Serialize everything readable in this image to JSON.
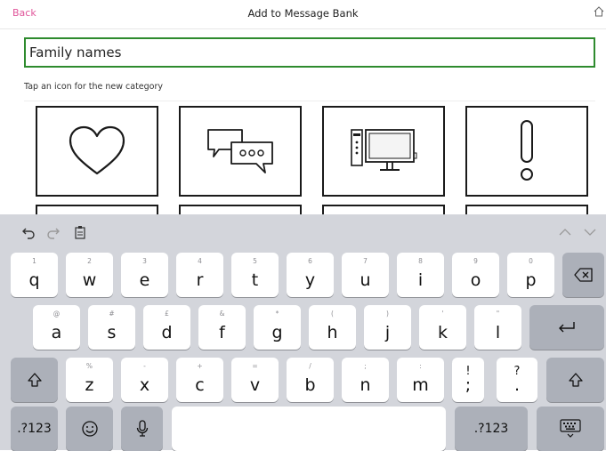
{
  "header": {
    "back_label": "Back",
    "title": "Add to Message Bank",
    "home_icon": "home-icon"
  },
  "input": {
    "value": "Family names",
    "placeholder": ""
  },
  "hint": "Tap an icon for the new category",
  "tiles": [
    {
      "icon": "heart-icon"
    },
    {
      "icon": "speech-bubbles-icon"
    },
    {
      "icon": "computer-monitor-icon"
    },
    {
      "icon": "exclamation-icon"
    }
  ],
  "keyboard": {
    "toolbar": {
      "undo_icon": "undo-icon",
      "redo_icon": "redo-icon",
      "paste_icon": "paste-icon",
      "up_icon": "chevron-up-icon",
      "down_icon": "chevron-down-icon"
    },
    "row1": [
      {
        "main": "q",
        "sub": "1"
      },
      {
        "main": "w",
        "sub": "2"
      },
      {
        "main": "e",
        "sub": "3"
      },
      {
        "main": "r",
        "sub": "4"
      },
      {
        "main": "t",
        "sub": "5"
      },
      {
        "main": "y",
        "sub": "6"
      },
      {
        "main": "u",
        "sub": "7"
      },
      {
        "main": "i",
        "sub": "8"
      },
      {
        "main": "o",
        "sub": "9"
      },
      {
        "main": "p",
        "sub": "0"
      }
    ],
    "row2": [
      {
        "main": "a",
        "sub": "@"
      },
      {
        "main": "s",
        "sub": "#"
      },
      {
        "main": "d",
        "sub": "£"
      },
      {
        "main": "f",
        "sub": "&"
      },
      {
        "main": "g",
        "sub": "*"
      },
      {
        "main": "h",
        "sub": "("
      },
      {
        "main": "j",
        "sub": ")"
      },
      {
        "main": "k",
        "sub": "'"
      },
      {
        "main": "l",
        "sub": "\""
      }
    ],
    "row3": [
      {
        "main": "z",
        "sub": "%"
      },
      {
        "main": "x",
        "sub": "-"
      },
      {
        "main": "c",
        "sub": "+"
      },
      {
        "main": "v",
        "sub": "="
      },
      {
        "main": "b",
        "sub": "/"
      },
      {
        "main": "n",
        "sub": ";"
      },
      {
        "main": "m",
        "sub": ":"
      },
      {
        "main": ";",
        "sub": "!"
      },
      {
        "main": ".",
        "sub": "?"
      }
    ],
    "numbers_label": ".?123",
    "numbers_label_right": ".?123",
    "space_label": ""
  }
}
